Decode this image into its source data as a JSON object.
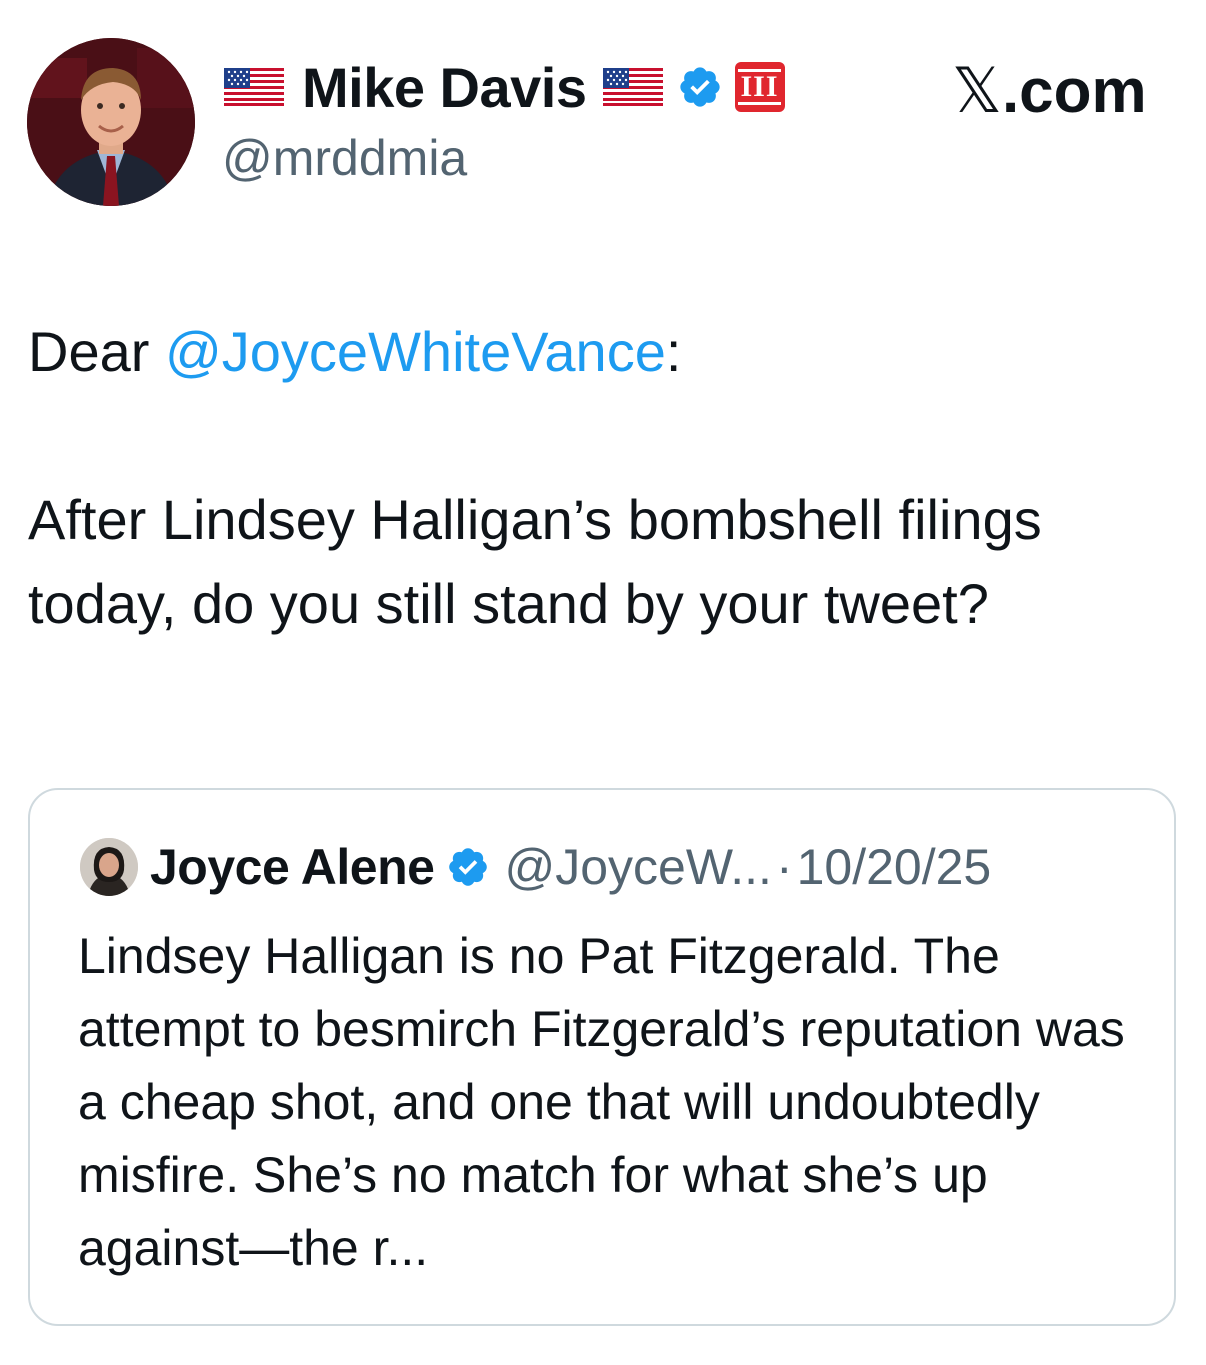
{
  "author": {
    "display_name": "Mike Davis",
    "handle": "@mrddmia",
    "badges": [
      "us-flag",
      "us-flag",
      "verified-badge",
      "roman-numeral-three-badge"
    ],
    "roman_badge_text": "III"
  },
  "brand": {
    "label": "𝕏.com",
    "x_glyph": "𝕏",
    "suffix": ".com"
  },
  "tweet": {
    "greeting_prefix": "Dear ",
    "mention": "@JoyceWhiteVance",
    "greeting_suffix": ":",
    "body": "After Lindsey Halligan’s bombshell filings today, do you still stand by your tweet?"
  },
  "quoted_tweet": {
    "display_name": "Joyce Alene",
    "handle": "@JoyceW...",
    "separator": "·",
    "date": "10/20/25",
    "text": "Lindsey Halligan is no Pat Fitzgerald. The attempt to besmirch Fitzgerald’s reputation was a cheap shot, and one that will undoubtedly misfire. She’s no match for what she’s up against—the r..."
  },
  "colors": {
    "text_primary": "#0f1419",
    "text_secondary": "#536471",
    "link": "#1d9bf0",
    "verified": "#1d9bf0",
    "badge_red": "#e0262e",
    "card_border": "#cfd9de"
  }
}
